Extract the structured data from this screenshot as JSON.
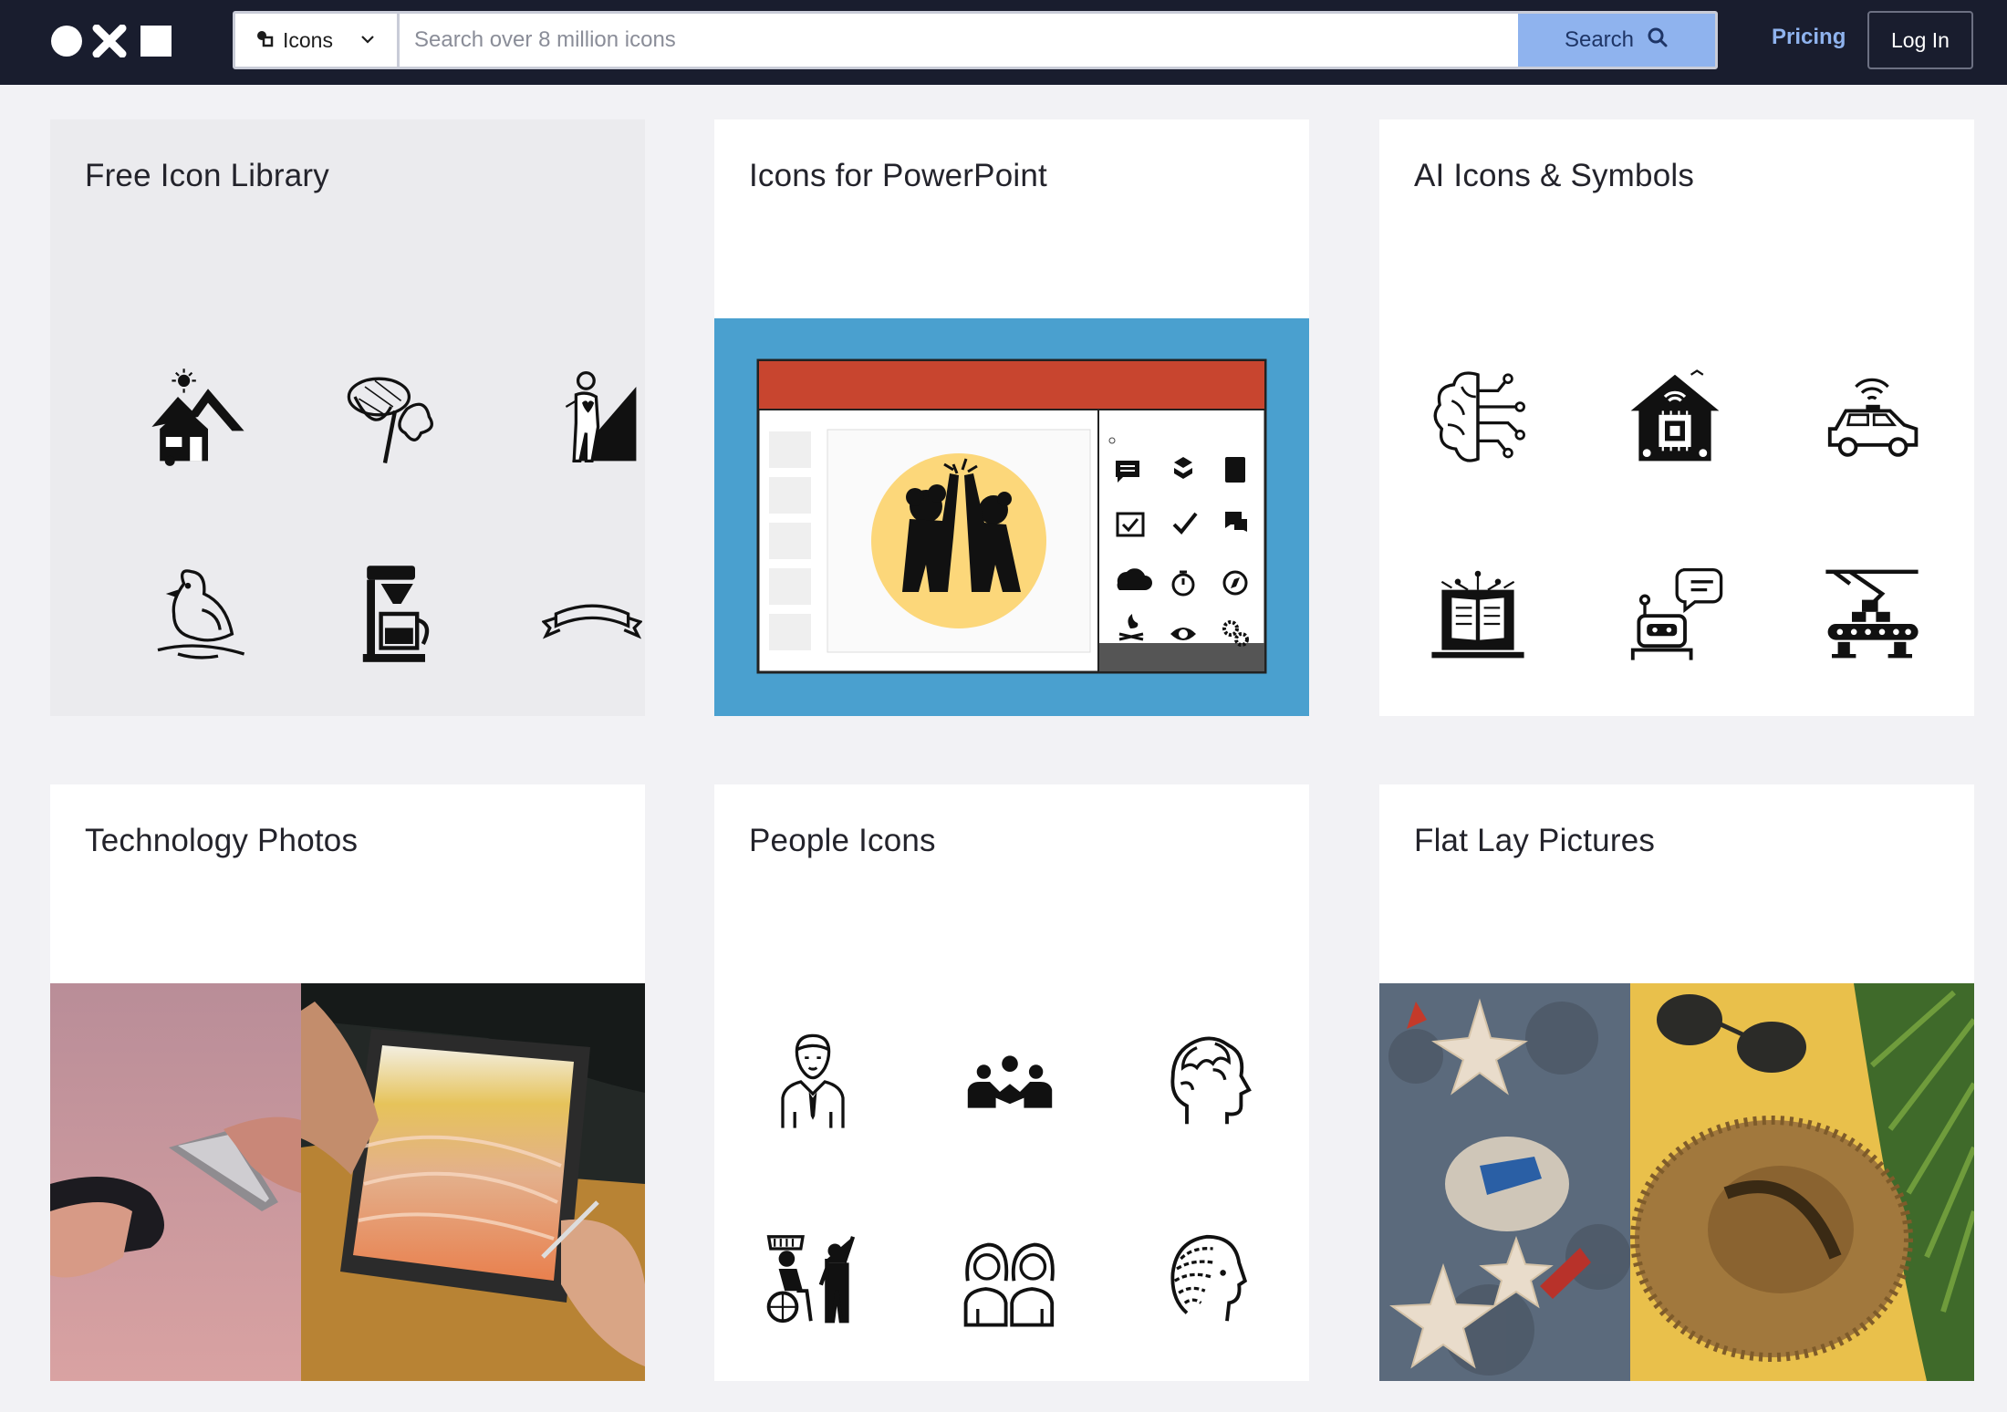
{
  "header": {
    "logo_alt": "logo-mark",
    "type_select": {
      "label": "Icons",
      "icon": "icons-type-icon"
    },
    "search": {
      "placeholder": "Search over 8 million icons",
      "value": "",
      "button_label": "Search"
    },
    "pricing_label": "Pricing",
    "login_label": "Log In"
  },
  "colors": {
    "header_bg": "#191d2e",
    "search_button": "#8fb3ee",
    "pricing_link": "#8fb3ee",
    "page_bg": "#f2f2f5",
    "powerpoint_bg": "#4aa0cf",
    "slide_header": "#c8452f",
    "highfive_circle": "#fcd77a"
  },
  "cards": [
    {
      "title": "Free Icon Library",
      "icons": [
        "house-mountain-icon",
        "butterfly-net-icon",
        "hiker-mountain-icon",
        "bird-branch-icon",
        "coffee-maker-icon",
        "ribbon-banner-icon"
      ]
    },
    {
      "title": "Icons for PowerPoint",
      "icons": [
        "high-five-icon"
      ]
    },
    {
      "title": "AI Icons & Symbols",
      "icons": [
        "ai-brain-icon",
        "smart-home-chip-icon",
        "self-driving-car-icon",
        "ai-book-laptop-icon",
        "chatbot-robot-icon",
        "robotic-conveyor-icon"
      ]
    },
    {
      "title": "Technology Photos",
      "icons": []
    },
    {
      "title": "People Icons",
      "icons": [
        "businessman-icon",
        "team-group-icon",
        "head-profile-icon",
        "wheelchair-support-icon",
        "two-women-icon",
        "braided-hair-head-icon"
      ]
    },
    {
      "title": "Flat Lay Pictures",
      "icons": []
    }
  ]
}
